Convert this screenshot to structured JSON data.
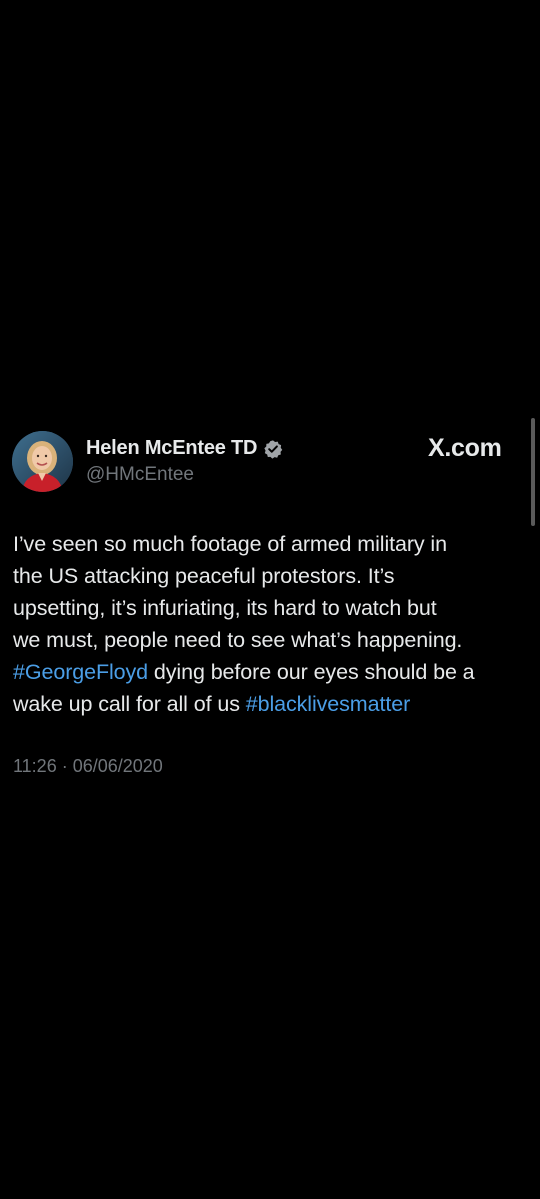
{
  "tweet": {
    "author": {
      "display_name": "Helen McEntee TD",
      "handle": "@HMcEntee",
      "verified_badge": "verified-badge-icon",
      "avatar": "profile-photo"
    },
    "brand": "X.com",
    "body": {
      "line1": "I’ve seen so much footage of armed military in",
      "line2": "the US attacking peaceful protestors. It’s",
      "line3": "upsetting, it’s infuriating, its hard to watch but",
      "line4": "we must, people need to see what’s happening.",
      "hashtag1": "#GeorgeFloyd",
      "line5_rest": " dying before our eyes should be a",
      "line6_start": "wake up call for all of us ",
      "hashtag2": "#blacklivesmatter"
    },
    "timestamp": "11:26 · 06/06/2020"
  },
  "colors": {
    "background": "#000000",
    "text": "#e7e9ea",
    "secondary_text": "#71767b",
    "hashtag": "#4b9ee6",
    "verified_badge": "#a0a4a8"
  }
}
